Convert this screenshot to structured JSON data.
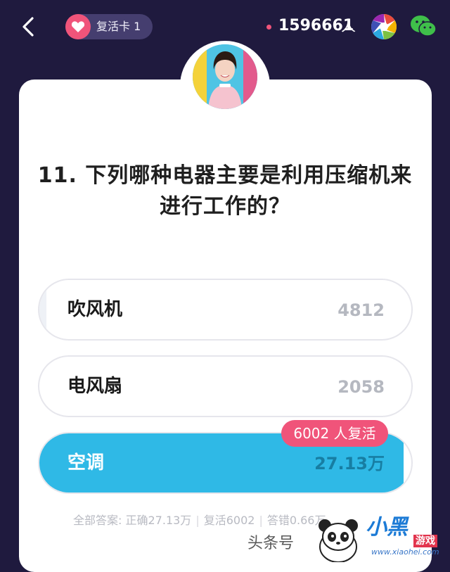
{
  "header": {
    "revive_card_label": "复活卡 1",
    "online_count": "1596661",
    "online_unit": "人"
  },
  "question": {
    "text": "11. 下列哪种电器主要是利用压缩机来进行工作的？"
  },
  "options": [
    {
      "label": "吹风机",
      "count": "4812"
    },
    {
      "label": "电风扇",
      "count": "2058"
    },
    {
      "label": "空调",
      "count": "27.13万",
      "correct": true,
      "fill_percent": 98
    }
  ],
  "revive_badge": "6002 人复活",
  "summary": {
    "all_answers": "全部答案:",
    "correct": "正确27.13万",
    "revived": "复活6002",
    "wrong": "答错0.66万"
  },
  "watermark": {
    "toutiao": "头条号",
    "site_title": "小黑",
    "site_game": "游戏",
    "site_url": "www.xiaohei.com"
  },
  "colors": {
    "background": "#1f1a3e",
    "accent_pink": "#f0547a",
    "correct_blue": "#2fb9e6"
  }
}
